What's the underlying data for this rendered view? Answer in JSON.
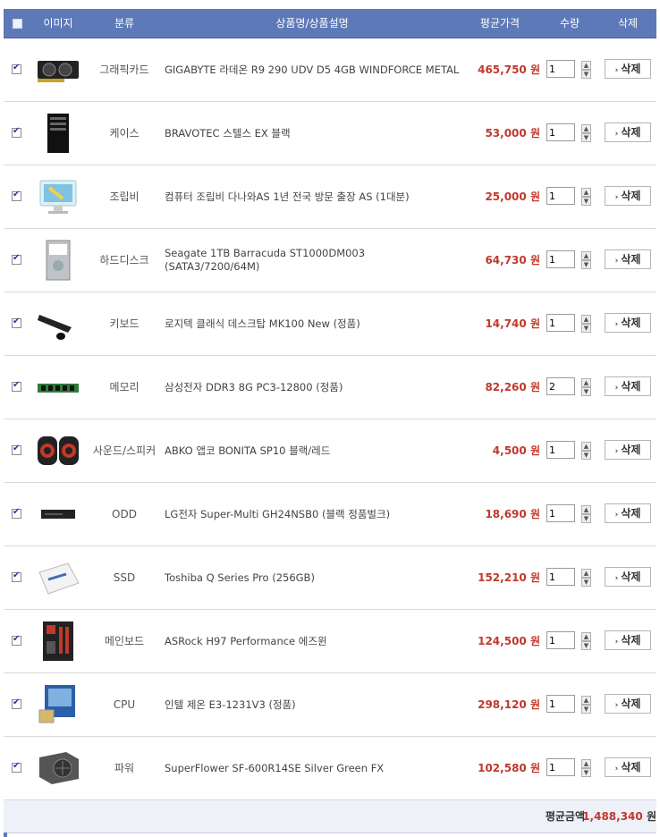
{
  "header": {
    "image_label": "이미지",
    "category_label": "분류",
    "name_label": "상품명/상품설명",
    "price_label": "평균가격",
    "qty_label": "수량",
    "delete_label": "삭제"
  },
  "currency": "원",
  "delete_button_label": "삭제",
  "items": [
    {
      "category": "그래픽카드",
      "name": "GIGABYTE 라데온 R9 290 UDV D5 4GB WINDFORCE METAL",
      "price": "465,750",
      "qty": "1",
      "checked": true,
      "icon": "graphics-card-icon"
    },
    {
      "category": "케이스",
      "name": "BRAVOTEC 스텔스 EX 블랙",
      "price": "53,000",
      "qty": "1",
      "checked": true,
      "icon": "pc-case-icon"
    },
    {
      "category": "조립비",
      "name": "컴퓨터 조립비 다나와AS 1년 전국 방문 출장 AS (1대분)",
      "price": "25,000",
      "qty": "1",
      "checked": true,
      "icon": "assembly-service-icon"
    },
    {
      "category": "하드디스크",
      "name": "Seagate 1TB Barracuda ST1000DM003 (SATA3/7200/64M)",
      "price": "64,730",
      "qty": "1",
      "checked": true,
      "icon": "hard-disk-icon"
    },
    {
      "category": "키보드",
      "name": "로지텍 클래식 데스크탑 MK100 New (정품)",
      "price": "14,740",
      "qty": "1",
      "checked": true,
      "icon": "keyboard-icon"
    },
    {
      "category": "메모리",
      "name": "삼성전자 DDR3 8G PC3-12800 (정품)",
      "price": "82,260",
      "qty": "2",
      "checked": true,
      "icon": "memory-icon"
    },
    {
      "category": "사운드/스피커",
      "name": "ABKO 앱코 BONITA SP10 블랙/레드",
      "price": "4,500",
      "qty": "1",
      "checked": true,
      "icon": "speaker-icon"
    },
    {
      "category": "ODD",
      "name": "LG전자 Super-Multi GH24NSB0 (블랙 정품벌크)",
      "price": "18,690",
      "qty": "1",
      "checked": true,
      "icon": "optical-drive-icon"
    },
    {
      "category": "SSD",
      "name": "Toshiba Q Series Pro (256GB)",
      "price": "152,210",
      "qty": "1",
      "checked": true,
      "icon": "ssd-icon"
    },
    {
      "category": "메인보드",
      "name": "ASRock H97 Performance 에즈윈",
      "price": "124,500",
      "qty": "1",
      "checked": true,
      "icon": "motherboard-icon"
    },
    {
      "category": "CPU",
      "name": "인텔 제온 E3-1231V3 (정품)",
      "price": "298,120",
      "qty": "1",
      "checked": true,
      "icon": "cpu-icon"
    },
    {
      "category": "파워",
      "name": "SuperFlower SF-600R14SE Silver Green FX",
      "price": "102,580",
      "qty": "1",
      "checked": true,
      "icon": "power-supply-icon"
    }
  ],
  "total": {
    "label": "평균금액",
    "value": "1,488,340",
    "currency": "원"
  },
  "colors": {
    "header_bg": "#5d79b8",
    "price": "#c0392b",
    "total_bg": "#eef1f8"
  }
}
